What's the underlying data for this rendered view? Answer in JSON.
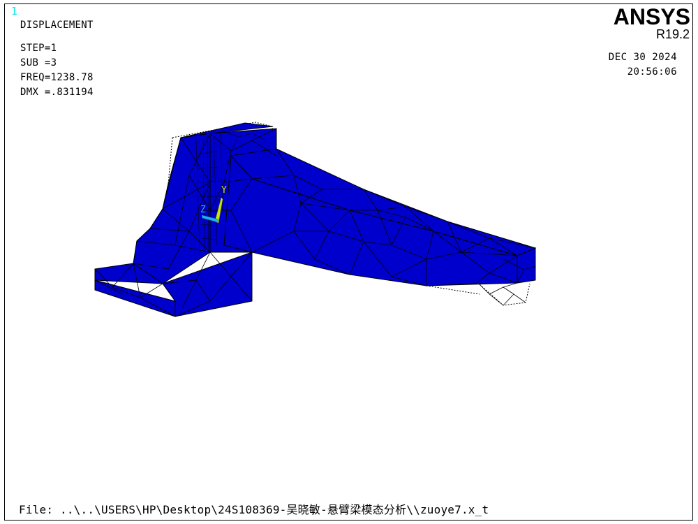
{
  "window_number": "1",
  "result_type": "DISPLACEMENT",
  "step": "STEP=1",
  "sub": "SUB =3",
  "freq": "FREQ=1238.78",
  "dmx": "DMX =.831194",
  "brand": "ANSYS",
  "version": "R19.2",
  "date": "DEC 30 2024",
  "time": "20:56:06",
  "file_line": "File: ..\\..\\USERS\\HP\\Desktop\\24S108369-吴晓敏-悬臂梁模态分析\\\\zuoye7.x_t",
  "triad": {
    "y_label": "Y",
    "z_label": "Z"
  },
  "colors": {
    "mesh_fill": "#0000cc",
    "mesh_lines": "#000000",
    "triad_y": "#c8e600",
    "triad_z": "#1fb2e6",
    "window_number": "#00e5e5"
  }
}
